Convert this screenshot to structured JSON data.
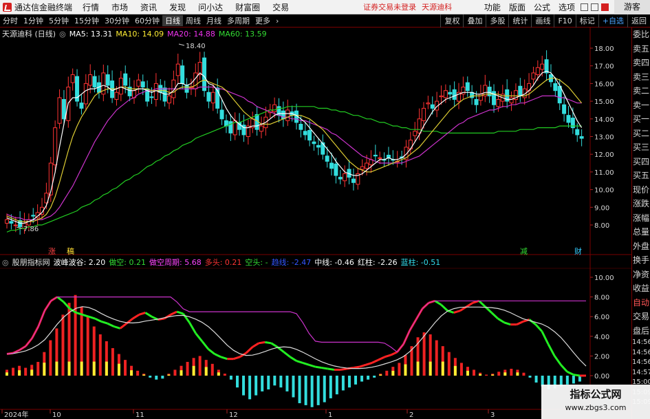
{
  "app": {
    "title": "通达信金融终端",
    "menu": [
      "行情",
      "市场",
      "资讯",
      "发现",
      "问小达",
      "财富圈",
      "交易"
    ],
    "notice": "证券交易未登录",
    "stock_tag": "天源迪科",
    "right_menu": [
      "功能",
      "版面",
      "公式",
      "选项"
    ],
    "guest": "游客"
  },
  "toolbar": {
    "periods": [
      "分时",
      "1分钟",
      "5分钟",
      "15分钟",
      "30分钟",
      "60分钟",
      "日线",
      "周线",
      "月线",
      "多周期",
      "更多"
    ],
    "active": "日线",
    "right_buttons": [
      "复权",
      "叠加",
      "多股",
      "统计",
      "画线",
      "F10",
      "标记",
      "+自选",
      "返回"
    ]
  },
  "sidebar": {
    "items": [
      "委比",
      "卖五",
      "卖四",
      "卖三",
      "卖二",
      "卖一",
      "买一",
      "买二",
      "买三",
      "买四",
      "买五",
      "现价",
      "涨跌",
      "涨幅",
      "总量",
      "外盘",
      "换手",
      "净资",
      "收益",
      "自动",
      "交易",
      "盘后"
    ],
    "times": [
      "14:56",
      "14:56",
      "14:56",
      "14:57",
      "15:00",
      "15:09",
      "15:09"
    ]
  },
  "main_legend": {
    "name": "天源迪科 (日线)",
    "ma5": "MA5: 13.31",
    "ma10": "MA10: 14.09",
    "ma20": "MA20: 14.88",
    "ma60": "MA60: 13.59"
  },
  "main_labels": {
    "high": "18.40",
    "low": "7.86"
  },
  "event_markers": [
    "涨",
    "稿",
    "减",
    "财"
  ],
  "sub_legend": {
    "name": "股朋指标网",
    "items": [
      {
        "label": "波峰波谷:",
        "value": "2.20",
        "color": "#ffffff"
      },
      {
        "label": "做空:",
        "value": "0.21",
        "color": "#33dd33"
      },
      {
        "label": "做空周期:",
        "value": "5.68",
        "color": "#ff44ff"
      },
      {
        "label": "多头:",
        "value": "0.21",
        "color": "#ff3333"
      },
      {
        "label": "空头:",
        "value": "-",
        "color": "#33dd33"
      },
      {
        "label": "趋线:",
        "value": "-2.47",
        "color": "#3355ff"
      },
      {
        "label": "中线:",
        "value": "-0.46",
        "color": "#ffffff"
      },
      {
        "label": "红柱:",
        "value": "-2.26",
        "color": "#ffffff"
      },
      {
        "label": "蓝柱:",
        "value": "-0.51",
        "color": "#33ddee"
      }
    ]
  },
  "x_labels": [
    "2024年",
    "10",
    "11",
    "12",
    "1",
    "2",
    "3"
  ],
  "main_y_ticks": [
    "18.00",
    "17.00",
    "16.00",
    "15.00",
    "14.00",
    "13.00",
    "12.00",
    "11.00",
    "10.00",
    "9.00",
    "8.00"
  ],
  "sub_y_ticks": [
    "10.00",
    "8.00",
    "6.00",
    "4.00",
    "2.00",
    "0.00"
  ],
  "chart_data": {
    "type": "candlestick",
    "price": [
      8.3,
      8.1,
      8.0,
      7.9,
      8.1,
      8.3,
      8.5,
      8.7,
      9.0,
      9.8,
      11.5,
      13.5,
      15.2,
      14.0,
      15.8,
      16.5,
      15.0,
      14.6,
      16.0,
      16.5,
      15.8,
      15.5,
      16.6,
      15.9,
      15.2,
      15.5,
      16.3,
      15.9,
      15.3,
      15.6,
      16.2,
      15.8,
      15.0,
      15.2,
      16.0,
      15.5,
      15.0,
      15.3,
      16.2,
      17.1,
      16.0,
      15.5,
      15.8,
      16.6,
      17.2,
      15.6,
      15.0,
      15.5,
      14.6,
      14.0,
      13.6,
      13.2,
      13.9,
      13.4,
      13.1,
      13.6,
      14.0,
      13.4,
      13.6,
      14.1,
      14.5,
      14.8,
      14.2,
      14.0,
      14.5,
      14.2,
      13.8,
      13.4,
      13.1,
      12.8,
      12.6,
      12.4,
      12.0,
      11.6,
      11.2,
      10.8,
      10.6,
      10.9,
      10.7,
      10.4,
      10.9,
      11.3,
      11.5,
      11.7,
      11.9,
      11.8,
      11.7,
      11.8,
      11.7,
      11.6,
      11.8,
      12.4,
      12.8,
      13.3,
      14.0,
      14.6,
      14.9,
      14.6,
      15.0,
      15.3,
      15.6,
      15.4,
      15.1,
      15.5,
      15.8,
      15.6,
      15.2,
      14.8,
      15.4,
      15.9,
      15.3,
      14.8,
      15.1,
      15.4,
      15.0,
      15.2,
      15.6,
      15.3,
      15.7,
      16.0,
      16.6,
      16.9,
      17.1,
      16.6,
      16.1,
      15.6,
      14.9,
      14.3,
      13.8,
      13.5,
      13.1,
      12.9
    ],
    "ma5": [
      8.4,
      8.3,
      8.2,
      8.1,
      8.1,
      8.2,
      8.3,
      8.5,
      8.7,
      9.1,
      9.9,
      11.0,
      12.4,
      13.7,
      14.9,
      15.2,
      15.2,
      15.4,
      15.6,
      15.7,
      15.7,
      15.8,
      15.9,
      15.8,
      15.6,
      15.7,
      15.8,
      15.7,
      15.6,
      15.6,
      15.7,
      15.7,
      15.6,
      15.5,
      15.6,
      15.5,
      15.4,
      15.4,
      15.6,
      16.0,
      16.0,
      15.9,
      16.0,
      16.3,
      16.6,
      16.4,
      16.0,
      15.9,
      15.6,
      15.1,
      14.6,
      14.2,
      13.9,
      13.7,
      13.5,
      13.5,
      13.6,
      13.6,
      13.7,
      13.8,
      14.0,
      14.2,
      14.3,
      14.3,
      14.3,
      14.3,
      14.2,
      14.0,
      13.8,
      13.5,
      13.2,
      12.9,
      12.6,
      12.3,
      12.0,
      11.6,
      11.3,
      11.0,
      10.9,
      10.8,
      10.8,
      10.9,
      11.1,
      11.3,
      11.5,
      11.7,
      11.7,
      11.8,
      11.7,
      11.7,
      11.8,
      12.0,
      12.3,
      12.7,
      13.1,
      13.6,
      14.0,
      14.4,
      14.7,
      14.9,
      15.1,
      15.2,
      15.3,
      15.4,
      15.5,
      15.5,
      15.5,
      15.4,
      15.4,
      15.5,
      15.5,
      15.4,
      15.3,
      15.2,
      15.1,
      15.1,
      15.2,
      15.3,
      15.4,
      15.6,
      15.9,
      16.3,
      16.6,
      16.7,
      16.6,
      16.3,
      15.9,
      15.4,
      14.9,
      14.4,
      13.9,
      13.5
    ],
    "ma10": [
      8.5,
      8.4,
      8.3,
      8.2,
      8.2,
      8.2,
      8.2,
      8.3,
      8.4,
      8.6,
      9.0,
      9.6,
      10.4,
      11.3,
      12.2,
      13.0,
      13.6,
      14.1,
      14.5,
      14.9,
      15.3,
      15.5,
      15.6,
      15.7,
      15.7,
      15.7,
      15.8,
      15.8,
      15.7,
      15.7,
      15.7,
      15.7,
      15.7,
      15.6,
      15.6,
      15.6,
      15.6,
      15.5,
      15.5,
      15.7,
      15.8,
      15.8,
      15.8,
      15.9,
      16.1,
      16.2,
      16.1,
      16.0,
      15.9,
      15.8,
      15.6,
      15.3,
      15.0,
      14.7,
      14.4,
      14.2,
      14.0,
      13.9,
      13.7,
      13.7,
      13.7,
      13.8,
      13.9,
      14.0,
      14.1,
      14.2,
      14.2,
      14.2,
      14.1,
      14.0,
      13.8,
      13.6,
      13.4,
      13.1,
      12.8,
      12.5,
      12.2,
      11.9,
      11.6,
      11.4,
      11.2,
      11.1,
      11.0,
      11.0,
      11.1,
      11.2,
      11.3,
      11.4,
      11.5,
      11.6,
      11.7,
      11.8,
      12.0,
      12.2,
      12.4,
      12.7,
      13.0,
      13.3,
      13.6,
      13.9,
      14.2,
      14.5,
      14.7,
      14.9,
      15.1,
      15.2,
      15.3,
      15.3,
      15.3,
      15.4,
      15.4,
      15.4,
      15.4,
      15.3,
      15.3,
      15.3,
      15.3,
      15.3,
      15.3,
      15.4,
      15.6,
      15.8,
      16.0,
      16.2,
      16.3,
      16.3,
      16.2,
      16.0,
      15.8,
      15.5,
      15.2,
      14.9
    ],
    "ma20": [
      8.6,
      8.5,
      8.4,
      8.4,
      8.3,
      8.3,
      8.3,
      8.3,
      8.3,
      8.4,
      8.5,
      8.7,
      9.0,
      9.4,
      9.8,
      10.2,
      10.7,
      11.2,
      11.7,
      12.2,
      12.7,
      13.1,
      13.5,
      13.9,
      14.2,
      14.5,
      14.7,
      14.9,
      15.1,
      15.2,
      15.4,
      15.5,
      15.6,
      15.6,
      15.7,
      15.7,
      15.7,
      15.7,
      15.7,
      15.7,
      15.7,
      15.7,
      15.7,
      15.7,
      15.8,
      15.8,
      15.8,
      15.8,
      15.7,
      15.7,
      15.6,
      15.5,
      15.4,
      15.3,
      15.2,
      15.0,
      14.9,
      14.7,
      14.6,
      14.5,
      14.4,
      14.3,
      14.2,
      14.1,
      14.1,
      14.0,
      14.0,
      13.9,
      13.9,
      13.8,
      13.7,
      13.6,
      13.5,
      13.4,
      13.2,
      13.1,
      12.9,
      12.7,
      12.5,
      12.3,
      12.1,
      11.9,
      11.8,
      11.7,
      11.6,
      11.5,
      11.5,
      11.5,
      11.5,
      11.5,
      11.5,
      11.6,
      11.7,
      11.8,
      11.9,
      12.1,
      12.3,
      12.5,
      12.7,
      12.9,
      13.1,
      13.3,
      13.5,
      13.7,
      13.8,
      14.0,
      14.1,
      14.2,
      14.3,
      14.4,
      14.5,
      14.5,
      14.6,
      14.7,
      14.7,
      14.8,
      14.8,
      14.9,
      14.9,
      15.0,
      15.1,
      15.2,
      15.3,
      15.3,
      15.3,
      15.3,
      15.2,
      15.2,
      15.1,
      15.0,
      14.9,
      14.9
    ],
    "ma60": [
      7.6,
      7.7,
      7.7,
      7.8,
      7.8,
      7.9,
      7.9,
      8.0,
      8.0,
      8.1,
      8.2,
      8.3,
      8.4,
      8.5,
      8.6,
      8.7,
      8.8,
      9.0,
      9.1,
      9.2,
      9.4,
      9.5,
      9.7,
      9.8,
      10.0,
      10.1,
      10.3,
      10.5,
      10.6,
      10.8,
      10.9,
      11.1,
      11.3,
      11.4,
      11.6,
      11.7,
      11.9,
      12.0,
      12.2,
      12.3,
      12.5,
      12.6,
      12.7,
      12.9,
      13.0,
      13.1,
      13.2,
      13.3,
      13.4,
      13.5,
      13.6,
      13.7,
      13.8,
      13.8,
      13.9,
      14.0,
      14.1,
      14.2,
      14.3,
      14.4,
      14.5,
      14.5,
      14.6,
      14.6,
      14.7,
      14.7,
      14.7,
      14.7,
      14.7,
      14.7,
      14.7,
      14.6,
      14.6,
      14.6,
      14.5,
      14.5,
      14.4,
      14.4,
      14.3,
      14.2,
      14.2,
      14.1,
      14.0,
      14.0,
      13.9,
      13.8,
      13.8,
      13.7,
      13.6,
      13.6,
      13.5,
      13.5,
      13.4,
      13.4,
      13.4,
      13.3,
      13.3,
      13.3,
      13.3,
      13.2,
      13.2,
      13.2,
      13.2,
      13.2,
      13.2,
      13.2,
      13.2,
      13.2,
      13.2,
      13.2,
      13.2,
      13.2,
      13.3,
      13.3,
      13.3,
      13.3,
      13.3,
      13.4,
      13.4,
      13.4,
      13.4,
      13.5,
      13.5,
      13.5,
      13.5,
      13.5,
      13.6,
      13.6,
      13.6,
      13.6,
      13.6,
      13.6
    ],
    "oscillator": [
      2.2,
      2.3,
      2.6,
      3.0,
      3.8,
      5.0,
      6.6,
      7.6,
      8.0,
      7.5,
      6.8,
      6.4,
      6.2,
      6.0,
      5.8,
      5.5,
      5.3,
      5.0,
      4.8,
      5.3,
      5.8,
      6.2,
      6.4,
      6.0,
      5.7,
      5.8,
      6.2,
      6.5,
      6.3,
      5.4,
      4.3,
      3.5,
      2.7,
      2.2,
      1.9,
      1.7,
      1.7,
      1.9,
      2.3,
      2.9,
      3.3,
      3.4,
      3.3,
      2.9,
      2.4,
      1.9,
      1.5,
      1.3,
      1.1,
      0.9,
      0.8,
      0.7,
      0.6,
      0.6,
      0.7,
      0.8,
      0.9,
      1.1,
      1.3,
      1.6,
      1.9,
      2.1,
      2.4,
      3.2,
      4.6,
      5.7,
      6.8,
      7.4,
      7.6,
      7.2,
      6.6,
      6.4,
      6.6,
      7.0,
      7.4,
      7.6,
      7.0,
      6.4,
      5.8,
      5.4,
      5.2,
      5.2,
      5.5,
      5.7,
      5.2,
      4.5,
      3.2,
      2.0,
      1.1,
      0.4,
      0.1,
      0.0,
      0.0
    ],
    "bars": [
      0.6,
      0.8,
      1.0,
      0.8,
      1.1,
      1.4,
      2.4,
      3.6,
      4.8,
      6.2,
      7.4,
      8.2,
      7.0,
      6.0,
      5.0,
      4.2,
      3.5,
      2.8,
      2.2,
      1.6,
      1.0,
      0.5,
      0.2,
      -0.2,
      -0.4,
      -0.3,
      0.2,
      0.6,
      1.0,
      1.4,
      1.8,
      2.0,
      1.6,
      1.2,
      0.6,
      0.2,
      -0.4,
      -1.2,
      -2.0,
      -2.4,
      -2.0,
      -1.6,
      -1.4,
      -1.0,
      -1.2,
      -1.6,
      -2.2,
      -2.8,
      -3.0,
      -3.2,
      -3.0,
      -2.7,
      -2.3,
      -1.9,
      -1.5,
      -1.2,
      -0.9,
      -0.6,
      -0.4,
      -0.2,
      0.2,
      0.5,
      0.9,
      1.3,
      2.1,
      3.0,
      3.9,
      4.4,
      4.2,
      3.6,
      3.0,
      2.4,
      1.8,
      1.3,
      0.9,
      0.6,
      0.3,
      0.1,
      0.2,
      0.4,
      0.6,
      0.7,
      0.6,
      0.3,
      -0.2,
      -0.7,
      -1.1,
      -1.4,
      -1.3,
      -1.1,
      -0.9,
      -0.8,
      -0.6
    ]
  }
}
